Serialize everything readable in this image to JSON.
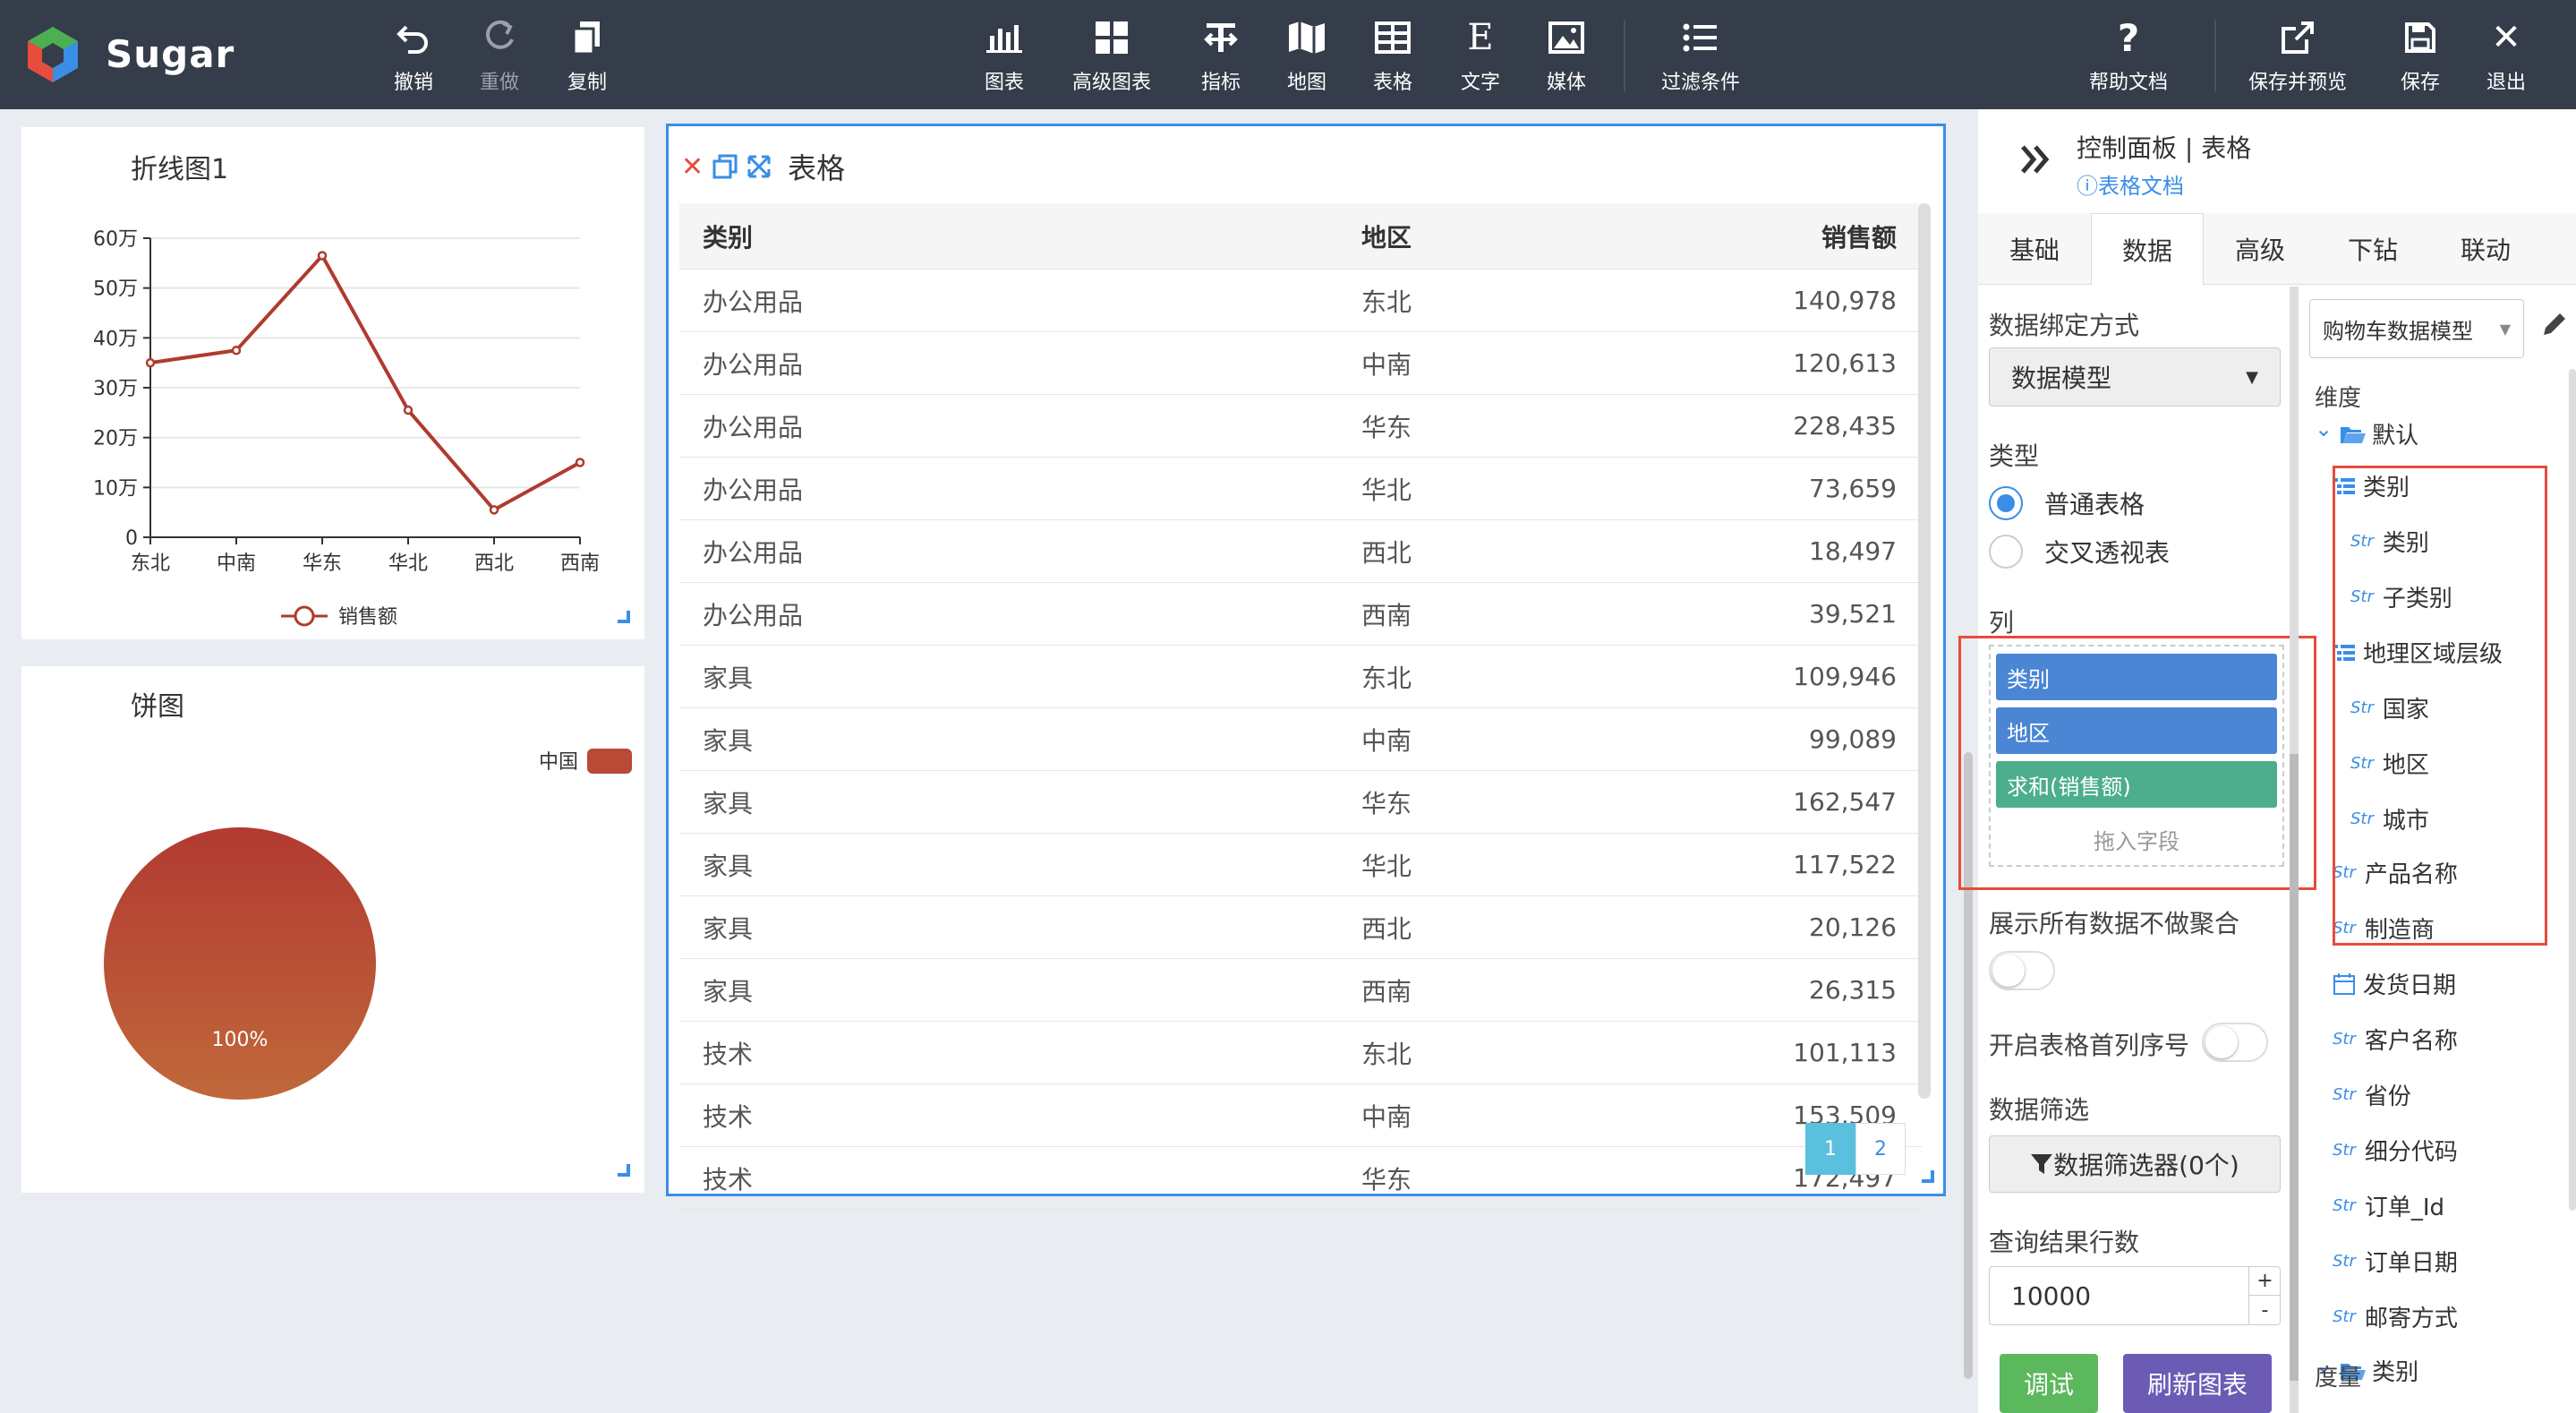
{
  "app": {
    "name": "Sugar"
  },
  "toolbar": {
    "left": [
      {
        "label": "撤销",
        "icon": "undo-icon"
      },
      {
        "label": "重做",
        "icon": "redo-icon"
      },
      {
        "label": "复制",
        "icon": "copy-icon"
      }
    ],
    "center": [
      {
        "label": "图表",
        "icon": "chart-icon"
      },
      {
        "label": "高级图表",
        "icon": "advanced-chart-icon"
      },
      {
        "label": "指标",
        "icon": "indicator-icon"
      },
      {
        "label": "地图",
        "icon": "map-icon"
      },
      {
        "label": "表格",
        "icon": "table-icon"
      },
      {
        "label": "文字",
        "icon": "text-icon"
      },
      {
        "label": "媒体",
        "icon": "media-icon"
      },
      {
        "label": "过滤条件",
        "icon": "filter-list-icon"
      }
    ],
    "right": [
      {
        "label": "帮助文档",
        "icon": "help-icon"
      },
      {
        "label": "保存并预览",
        "icon": "save-preview-icon"
      },
      {
        "label": "保存",
        "icon": "save-icon"
      },
      {
        "label": "退出",
        "icon": "close-icon"
      }
    ]
  },
  "line_card": {
    "title": "折线图1",
    "chart_data": {
      "type": "line",
      "categories": [
        "东北",
        "中南",
        "华东",
        "华北",
        "西北",
        "西南"
      ],
      "series": [
        {
          "name": "销售额",
          "values": [
            350000,
            375000,
            565000,
            255000,
            55000,
            150000
          ],
          "color": "#b03a2e"
        }
      ],
      "yticks": [
        "0",
        "10万",
        "20万",
        "30万",
        "40万",
        "50万",
        "60万"
      ],
      "ylim": [
        0,
        600000
      ],
      "legend": "bottom"
    }
  },
  "pie_card": {
    "title": "饼图",
    "chart_data": {
      "type": "pie",
      "slices": [
        {
          "name": "中国",
          "value": 100,
          "label": "100%",
          "color": "#b84a36"
        }
      ],
      "legend": "top-right"
    }
  },
  "table_card": {
    "title": "表格",
    "columns": [
      "类别",
      "地区",
      "销售额"
    ],
    "rows": [
      [
        "办公用品",
        "东北",
        "140,978"
      ],
      [
        "办公用品",
        "中南",
        "120,613"
      ],
      [
        "办公用品",
        "华东",
        "228,435"
      ],
      [
        "办公用品",
        "华北",
        "73,659"
      ],
      [
        "办公用品",
        "西北",
        "18,497"
      ],
      [
        "办公用品",
        "西南",
        "39,521"
      ],
      [
        "家具",
        "东北",
        "109,946"
      ],
      [
        "家具",
        "中南",
        "99,089"
      ],
      [
        "家具",
        "华东",
        "162,547"
      ],
      [
        "家具",
        "华北",
        "117,522"
      ],
      [
        "家具",
        "西北",
        "20,126"
      ],
      [
        "家具",
        "西南",
        "26,315"
      ],
      [
        "技术",
        "东北",
        "101,113"
      ],
      [
        "技术",
        "中南",
        "153,509"
      ],
      [
        "技术",
        "华东",
        "172,497"
      ]
    ],
    "pages": [
      "1",
      "2"
    ],
    "current_page": "1"
  },
  "panel": {
    "title": "控制面板 | 表格",
    "doc_link": "表格文档",
    "tabs": [
      "基础",
      "数据",
      "高级",
      "下钻",
      "联动"
    ],
    "active_tab": "数据",
    "binding_label": "数据绑定方式",
    "binding_value": "数据模型",
    "type_label": "类型",
    "type_options": [
      "普通表格",
      "交叉透视表"
    ],
    "type_selected": "普通表格",
    "columns_label": "列",
    "column_chips": [
      {
        "label": "类别",
        "color": "#4a86d4"
      },
      {
        "label": "地区",
        "color": "#4a86d4"
      },
      {
        "label": "求和(销售额)",
        "color": "#4cae8c"
      }
    ],
    "drop_hint": "拖入字段",
    "show_all_label": "展示所有数据不做聚合",
    "index_col_label": "开启表格首列序号",
    "filter_label": "数据筛选",
    "filter_button": "数据筛选器(0个)",
    "limit_label": "查询结果行数",
    "limit_value": "10000",
    "debug_button": "调试",
    "refresh_button": "刷新图表"
  },
  "model": {
    "selected": "购物车数据模型",
    "dimension_label": "维度",
    "measure_label": "度量",
    "tree": [
      {
        "label": "默认",
        "kind": "folder"
      },
      {
        "label": "类别",
        "kind": "hierarchy"
      },
      {
        "label": "类别",
        "kind": "str"
      },
      {
        "label": "子类别",
        "kind": "str"
      },
      {
        "label": "地理区域层级",
        "kind": "hierarchy"
      },
      {
        "label": "国家",
        "kind": "str"
      },
      {
        "label": "地区",
        "kind": "str"
      },
      {
        "label": "城市",
        "kind": "str"
      },
      {
        "label": "产品名称",
        "kind": "str"
      },
      {
        "label": "制造商",
        "kind": "str"
      },
      {
        "label": "发货日期",
        "kind": "date"
      },
      {
        "label": "客户名称",
        "kind": "str"
      },
      {
        "label": "省份",
        "kind": "str"
      },
      {
        "label": "细分代码",
        "kind": "str"
      },
      {
        "label": "订单_Id",
        "kind": "str"
      },
      {
        "label": "订单日期",
        "kind": "str"
      },
      {
        "label": "邮寄方式",
        "kind": "str"
      },
      {
        "label": "类别",
        "kind": "folder"
      }
    ],
    "str_tag": "Str"
  },
  "colors": {
    "topbar": "#353c4a",
    "accent": "#3a8ee6",
    "highlight": "#e74c3c"
  }
}
